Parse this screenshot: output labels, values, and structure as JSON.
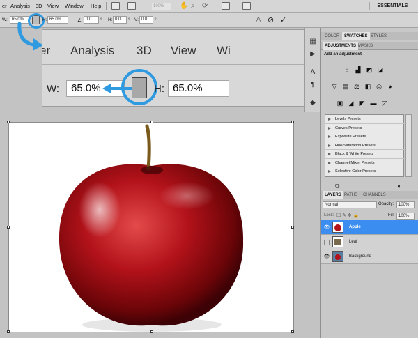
{
  "menubar": {
    "items": [
      "er",
      "Analysis",
      "3D",
      "View",
      "Window",
      "Help"
    ],
    "zoom": "100%",
    "workspace": "ESSENTIALS"
  },
  "options": {
    "w_label": "W:",
    "w_value": "65.0%",
    "h_label": "H:",
    "h_value": "65.0%",
    "angle_value": "0.0",
    "hskew_label": "H:",
    "hskew_value": "0.0",
    "vskew_label": "V:",
    "vskew_value": "0.0",
    "deg": "°"
  },
  "callout": {
    "menu": [
      "er",
      "Analysis",
      "3D",
      "View",
      "Wi"
    ],
    "w_label": "W:",
    "w_value": "65.0%",
    "h_label": "H:",
    "h_value": "65.0%"
  },
  "panels": {
    "top_tabs": [
      "COLOR",
      "SWATCHES",
      "STYLES"
    ],
    "adj_tabs": [
      "ADJUSTMENTS",
      "MASKS"
    ],
    "adj_title": "Add an adjustment",
    "presets": [
      "Levels Presets",
      "Curves Presets",
      "Exposure Presets",
      "Hue/Saturation Presets",
      "Black & White Presets",
      "Channel Mixer Presets",
      "Selective Color Presets"
    ],
    "layer_tabs": [
      "LAYERS",
      "PATHS",
      "CHANNELS"
    ],
    "blend_mode": "Normal",
    "opacity_label": "Opacity:",
    "opacity_value": "100%",
    "lock_label": "Lock:",
    "fill_label": "Fill:",
    "fill_value": "100%",
    "layers": [
      {
        "name": "Apple",
        "selected": true,
        "visible": true
      },
      {
        "name": "Leaf",
        "selected": false,
        "visible": false
      },
      {
        "name": "Background",
        "selected": false,
        "visible": true
      }
    ]
  },
  "colors": {
    "accent_highlight": "#2f9ae0",
    "layer_selected": "#3b8ef0",
    "apple_red": "#b3121a"
  }
}
